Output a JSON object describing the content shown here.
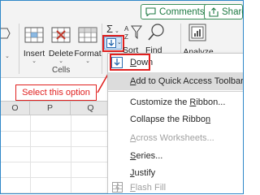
{
  "ribbon": {
    "comments_label": "Comments",
    "share_label": "Share",
    "insert_label": "Insert",
    "delete_label": "Delete",
    "format_label": "Format",
    "cells_group_label": "Cells",
    "sort_filter_label": "Sort &",
    "find_select_label": "Find &",
    "analyze_label": "Analyze",
    "analyze_label2": "a",
    "sigma_symbol": "Σ",
    "fill_icon": "fill-down-icon"
  },
  "columns": [
    "O",
    "P",
    "Q"
  ],
  "menu": {
    "items": [
      {
        "label": "Down",
        "underline_char": "D",
        "icon": "arrow-down-icon",
        "state": "selected"
      },
      {
        "label": "Add to Quick Access Toolbar",
        "underline_char": "A",
        "state": "highlighted"
      },
      {
        "label": "Customize the Ribbon...",
        "underline_char": "R",
        "state": "normal"
      },
      {
        "label": "Collapse the Ribbon",
        "underline_char": "n",
        "state": "normal"
      },
      {
        "label": "Across Worksheets...",
        "underline_char": "A",
        "state": "disabled"
      },
      {
        "label": "Series...",
        "underline_char": "S",
        "state": "normal"
      },
      {
        "label": "Justify",
        "underline_char": "J",
        "state": "normal"
      },
      {
        "label": "Flash Fill",
        "underline_char": "F",
        "icon": "flash-fill-icon",
        "state": "disabled"
      }
    ]
  },
  "annotation": {
    "callout_text": "Select this option",
    "accent_color": "#e0201f"
  },
  "colors": {
    "frame_border": "#2e87c8",
    "comments_green": "#1e7a43",
    "ribbon_bg": "#f3f3f3",
    "highlight_bg": "#dcdcdc"
  }
}
